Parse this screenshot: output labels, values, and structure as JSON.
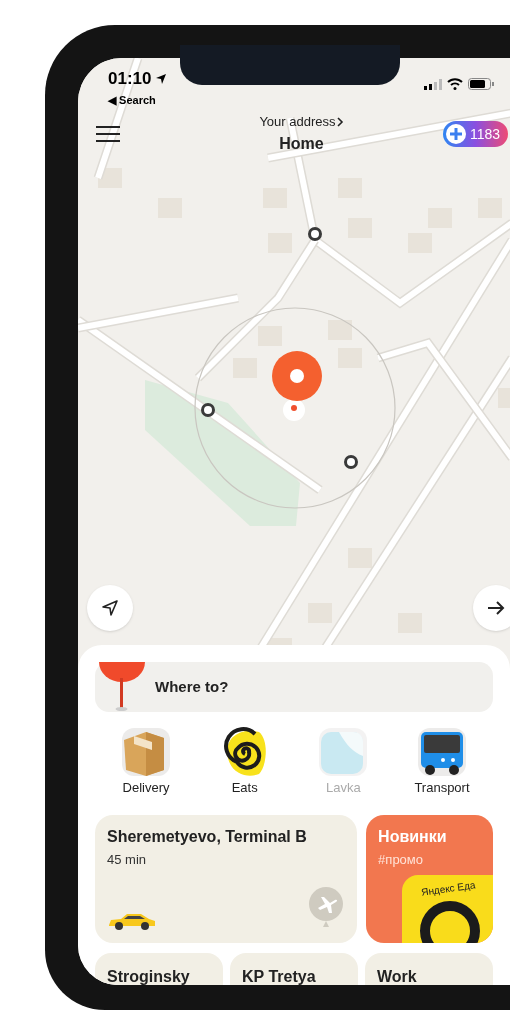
{
  "status_bar": {
    "time": "01:10",
    "back": "◀ Search"
  },
  "header": {
    "address_label": "Your address",
    "address": "Home",
    "points": "1183"
  },
  "search": {
    "placeholder": "Where to?"
  },
  "services": [
    {
      "label": "Delivery",
      "kind": "box",
      "disabled": false
    },
    {
      "label": "Eats",
      "kind": "spiral",
      "disabled": false
    },
    {
      "label": "Lavka",
      "kind": "leaf",
      "disabled": true
    },
    {
      "label": "Transport",
      "kind": "bus",
      "disabled": false
    }
  ],
  "shortcuts": [
    {
      "kind": "route",
      "title": "Sheremetyevo, Terminal B",
      "subtitle": "45 min"
    },
    {
      "kind": "promo",
      "title": "Новинки",
      "subtitle": "#промо",
      "art_text": "Яндекс Еда"
    }
  ],
  "places": [
    {
      "title": "Stroginsky"
    },
    {
      "title": "KP Tretya"
    },
    {
      "title": "Work"
    }
  ]
}
